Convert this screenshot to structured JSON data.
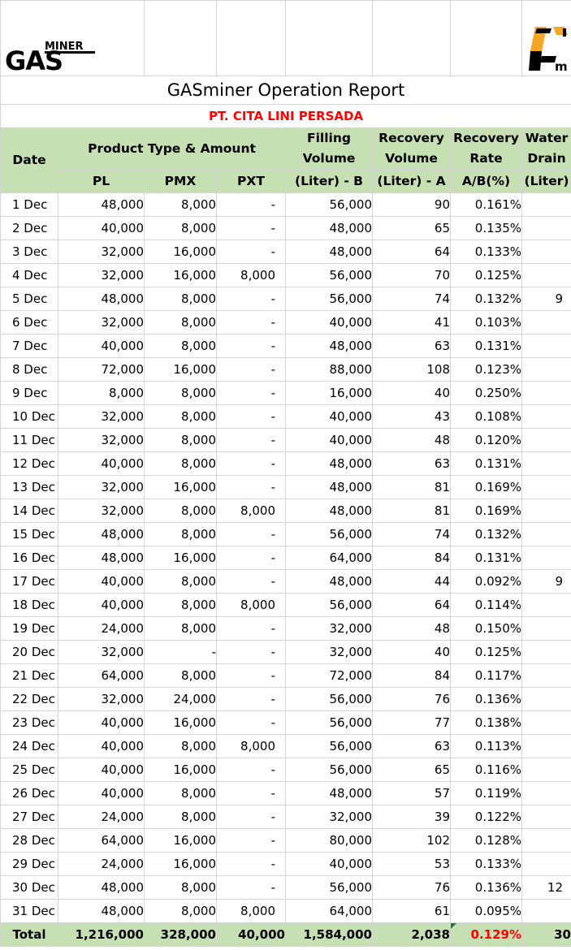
{
  "brand": {
    "miner": "MINER",
    "gas": "GAS",
    "cl_suffix": "m"
  },
  "report_title": "GASminer Operation Report",
  "company": "PT. CITA LINI PERSADA",
  "headers": {
    "date": "Date",
    "product_group": "Product Type & Amount",
    "pl": "PL",
    "pmx": "PMX",
    "pxt": "PXT",
    "filling_line1": "Filling",
    "filling_line2": "Volume",
    "filling_unit": "(Liter) - B",
    "recovery_line1": "Recovery",
    "recovery_line2": "Volume",
    "recovery_unit": "(Liter) - A",
    "rate_line1": "Recovery",
    "rate_line2": "Rate",
    "rate_unit": "A/B(%)",
    "drain_line1": "Water",
    "drain_line2": "Drain",
    "drain_unit": "(Liter)"
  },
  "rows": [
    {
      "date": "1 Dec",
      "pl": "48,000",
      "pmx": "8,000",
      "pxt": "-",
      "filling": "56,000",
      "recovery": "90",
      "rate": "0.161%",
      "drain": ""
    },
    {
      "date": "2 Dec",
      "pl": "40,000",
      "pmx": "8,000",
      "pxt": "-",
      "filling": "48,000",
      "recovery": "65",
      "rate": "0.135%",
      "drain": ""
    },
    {
      "date": "3 Dec",
      "pl": "32,000",
      "pmx": "16,000",
      "pxt": "-",
      "filling": "48,000",
      "recovery": "64",
      "rate": "0.133%",
      "drain": ""
    },
    {
      "date": "4 Dec",
      "pl": "32,000",
      "pmx": "16,000",
      "pxt": "8,000",
      "filling": "56,000",
      "recovery": "70",
      "rate": "0.125%",
      "drain": ""
    },
    {
      "date": "5 Dec",
      "pl": "48,000",
      "pmx": "8,000",
      "pxt": "-",
      "filling": "56,000",
      "recovery": "74",
      "rate": "0.132%",
      "drain": "9"
    },
    {
      "date": "6 Dec",
      "pl": "32,000",
      "pmx": "8,000",
      "pxt": "-",
      "filling": "40,000",
      "recovery": "41",
      "rate": "0.103%",
      "drain": ""
    },
    {
      "date": "7 Dec",
      "pl": "40,000",
      "pmx": "8,000",
      "pxt": "-",
      "filling": "48,000",
      "recovery": "63",
      "rate": "0.131%",
      "drain": ""
    },
    {
      "date": "8 Dec",
      "pl": "72,000",
      "pmx": "16,000",
      "pxt": "-",
      "filling": "88,000",
      "recovery": "108",
      "rate": "0.123%",
      "drain": ""
    },
    {
      "date": "9 Dec",
      "pl": "8,000",
      "pmx": "8,000",
      "pxt": "-",
      "filling": "16,000",
      "recovery": "40",
      "rate": "0.250%",
      "drain": ""
    },
    {
      "date": "10 Dec",
      "pl": "32,000",
      "pmx": "8,000",
      "pxt": "-",
      "filling": "40,000",
      "recovery": "43",
      "rate": "0.108%",
      "drain": ""
    },
    {
      "date": "11 Dec",
      "pl": "32,000",
      "pmx": "8,000",
      "pxt": "-",
      "filling": "40,000",
      "recovery": "48",
      "rate": "0.120%",
      "drain": ""
    },
    {
      "date": "12 Dec",
      "pl": "40,000",
      "pmx": "8,000",
      "pxt": "-",
      "filling": "48,000",
      "recovery": "63",
      "rate": "0.131%",
      "drain": ""
    },
    {
      "date": "13 Dec",
      "pl": "32,000",
      "pmx": "16,000",
      "pxt": "-",
      "filling": "48,000",
      "recovery": "81",
      "rate": "0.169%",
      "drain": ""
    },
    {
      "date": "14 Dec",
      "pl": "32,000",
      "pmx": "8,000",
      "pxt": "8,000",
      "filling": "48,000",
      "recovery": "81",
      "rate": "0.169%",
      "drain": ""
    },
    {
      "date": "15 Dec",
      "pl": "48,000",
      "pmx": "8,000",
      "pxt": "-",
      "filling": "56,000",
      "recovery": "74",
      "rate": "0.132%",
      "drain": ""
    },
    {
      "date": "16 Dec",
      "pl": "48,000",
      "pmx": "16,000",
      "pxt": "-",
      "filling": "64,000",
      "recovery": "84",
      "rate": "0.131%",
      "drain": ""
    },
    {
      "date": "17 Dec",
      "pl": "40,000",
      "pmx": "8,000",
      "pxt": "-",
      "filling": "48,000",
      "recovery": "44",
      "rate": "0.092%",
      "drain": "9"
    },
    {
      "date": "18 Dec",
      "pl": "40,000",
      "pmx": "8,000",
      "pxt": "8,000",
      "filling": "56,000",
      "recovery": "64",
      "rate": "0.114%",
      "drain": ""
    },
    {
      "date": "19 Dec",
      "pl": "24,000",
      "pmx": "8,000",
      "pxt": "-",
      "filling": "32,000",
      "recovery": "48",
      "rate": "0.150%",
      "drain": ""
    },
    {
      "date": "20 Dec",
      "pl": "32,000",
      "pmx": "-",
      "pxt": "-",
      "filling": "32,000",
      "recovery": "40",
      "rate": "0.125%",
      "drain": ""
    },
    {
      "date": "21 Dec",
      "pl": "64,000",
      "pmx": "8,000",
      "pxt": "-",
      "filling": "72,000",
      "recovery": "84",
      "rate": "0.117%",
      "drain": ""
    },
    {
      "date": "22 Dec",
      "pl": "32,000",
      "pmx": "24,000",
      "pxt": "-",
      "filling": "56,000",
      "recovery": "76",
      "rate": "0.136%",
      "drain": ""
    },
    {
      "date": "23 Dec",
      "pl": "40,000",
      "pmx": "16,000",
      "pxt": "-",
      "filling": "56,000",
      "recovery": "77",
      "rate": "0.138%",
      "drain": ""
    },
    {
      "date": "24 Dec",
      "pl": "40,000",
      "pmx": "8,000",
      "pxt": "8,000",
      "filling": "56,000",
      "recovery": "63",
      "rate": "0.113%",
      "drain": ""
    },
    {
      "date": "25 Dec",
      "pl": "40,000",
      "pmx": "16,000",
      "pxt": "-",
      "filling": "56,000",
      "recovery": "65",
      "rate": "0.116%",
      "drain": ""
    },
    {
      "date": "26 Dec",
      "pl": "40,000",
      "pmx": "8,000",
      "pxt": "-",
      "filling": "48,000",
      "recovery": "57",
      "rate": "0.119%",
      "drain": ""
    },
    {
      "date": "27 Dec",
      "pl": "24,000",
      "pmx": "8,000",
      "pxt": "-",
      "filling": "32,000",
      "recovery": "39",
      "rate": "0.122%",
      "drain": ""
    },
    {
      "date": "28 Dec",
      "pl": "64,000",
      "pmx": "16,000",
      "pxt": "-",
      "filling": "80,000",
      "recovery": "102",
      "rate": "0.128%",
      "drain": ""
    },
    {
      "date": "29 Dec",
      "pl": "24,000",
      "pmx": "16,000",
      "pxt": "-",
      "filling": "40,000",
      "recovery": "53",
      "rate": "0.133%",
      "drain": ""
    },
    {
      "date": "30 Dec",
      "pl": "48,000",
      "pmx": "8,000",
      "pxt": "-",
      "filling": "56,000",
      "recovery": "76",
      "rate": "0.136%",
      "drain": "12"
    },
    {
      "date": "31 Dec",
      "pl": "48,000",
      "pmx": "8,000",
      "pxt": "8,000",
      "filling": "64,000",
      "recovery": "61",
      "rate": "0.095%",
      "drain": ""
    }
  ],
  "total": {
    "date": "Total",
    "pl": "1,216,000",
    "pmx": "328,000",
    "pxt": "40,000",
    "filling": "1,584,000",
    "recovery": "2,038",
    "rate": "0.129%",
    "drain": "30"
  },
  "colors": {
    "header_bg": "#c6e0b4",
    "highlight": "#ff0000",
    "accent_orange": "#f5a623"
  }
}
